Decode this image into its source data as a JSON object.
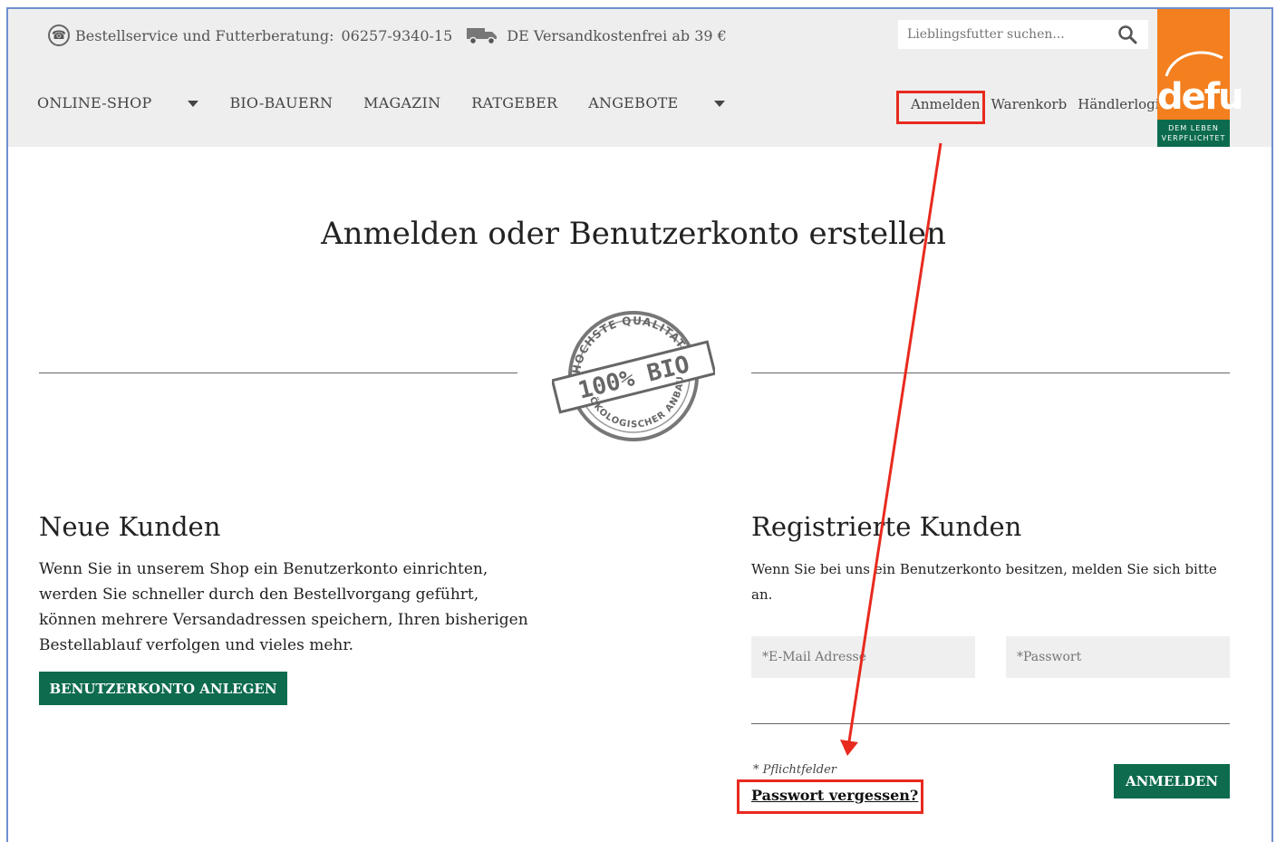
{
  "header": {
    "service_label": "Bestellservice und Futterberatung:",
    "phone": "06257-9340-15",
    "shipping": "DE Versandkostenfrei ab 39 €",
    "search_placeholder": "Lieblingsfutter suchen..."
  },
  "nav": {
    "items": [
      "ONLINE-SHOP",
      "BIO-BAUERN",
      "MAGAZIN",
      "RATGEBER",
      "ANGEBOTE"
    ]
  },
  "usernav": {
    "login": "Anmelden",
    "cart": "Warenkorb",
    "dealer_login": "Händlerlogin"
  },
  "logo": {
    "word": "defu",
    "tagline_line1": "DEM LEBEN",
    "tagline_line2": "VERPFLICHTET"
  },
  "main": {
    "title": "Anmelden oder Benutzerkonto erstellen",
    "stamp": {
      "top": "HÖCHSTE QUALITÄT",
      "center": "100% BIO",
      "bottom": "ÖKOLOGISCHER ANBAU"
    }
  },
  "new_customers": {
    "heading": "Neue Kunden",
    "text": "Wenn Sie in unserem Shop ein Benutzerkonto einrichten, werden Sie schneller durch den Bestellvorgang geführt, können mehrere Versandadressen speichern, Ihren bisherigen Bestellablauf verfolgen und vieles mehr.",
    "button": "BENUTZERKONTO ANLEGEN"
  },
  "registered_customers": {
    "heading": "Registrierte Kunden",
    "text": "Wenn Sie bei uns ein Benutzerkonto besitzen, melden Sie sich bitte an.",
    "email_placeholder": "*E-Mail Adresse",
    "password_placeholder": "*Passwort",
    "required_note": "* Pflichtfelder",
    "forgot": "Passwort vergessen?",
    "submit": "ANMELDEN"
  },
  "colors": {
    "brand_orange": "#f47f1e",
    "brand_green": "#0e6b4e",
    "highlight_red": "#e82a1f"
  }
}
